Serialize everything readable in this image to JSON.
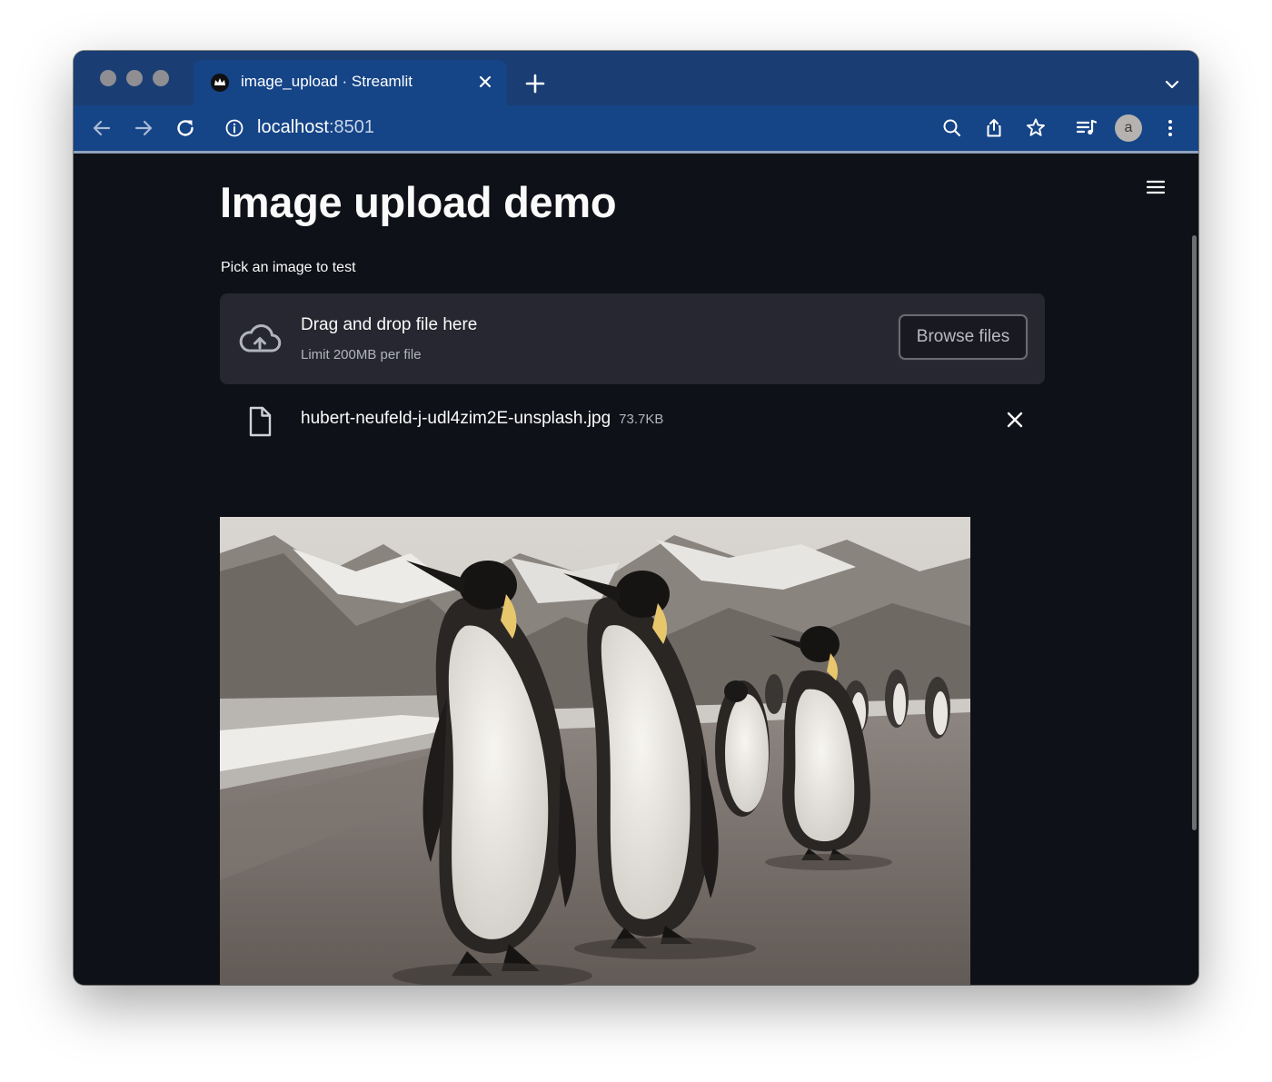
{
  "browser": {
    "tab_title": "image_upload · Streamlit",
    "url_host": "localhost",
    "url_port": ":8501",
    "profile_initial": "a"
  },
  "page": {
    "title": "Image upload demo",
    "uploader_label": "Pick an image to test",
    "dropzone_title": "Drag and drop file here",
    "dropzone_limit": "Limit 200MB per file",
    "browse_label": "Browse files"
  },
  "uploaded_file": {
    "name": "hubert-neufeld-j-udl4zim2E-unsplash.jpg",
    "size": "73.7KB"
  },
  "icons": {
    "tab_favicon": "streamlit-crown-icon",
    "upload": "cloud-upload-icon",
    "file": "file-icon",
    "remove": "close-icon",
    "menu": "hamburger-icon"
  },
  "colors": {
    "browser_frame": "#1a3e73",
    "toolbar": "#154487",
    "app_background": "#0e1117",
    "dropzone_background": "#262730",
    "text": "#fafafa"
  }
}
